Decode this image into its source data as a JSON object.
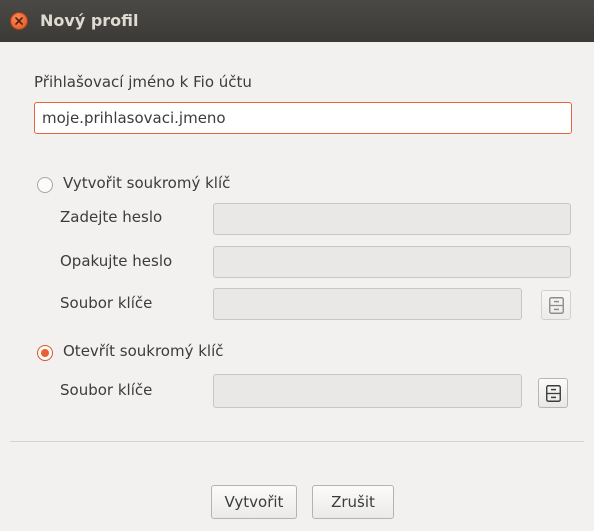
{
  "window": {
    "title": "Nový profil"
  },
  "login": {
    "label": "Přihlašovací jméno k Fio účtu",
    "value": "moje.prihlasovaci.jmeno"
  },
  "create_key": {
    "label": "Vytvořit soukromý klíč",
    "selected": false,
    "password_label": "Zadejte heslo",
    "repeat_label": "Opakujte heslo",
    "file_label": "Soubor klíče"
  },
  "open_key": {
    "label": "Otevřít soukromý klíč",
    "selected": true,
    "file_label": "Soubor klíče"
  },
  "buttons": {
    "create": "Vytvořit",
    "cancel": "Zrušit"
  },
  "colors": {
    "accent": "#e2683c",
    "titlebar": "#3b3a36",
    "background": "#f2f1f0"
  },
  "icons": {
    "close": "close-icon",
    "file_browse": "file-cabinet-icon"
  }
}
